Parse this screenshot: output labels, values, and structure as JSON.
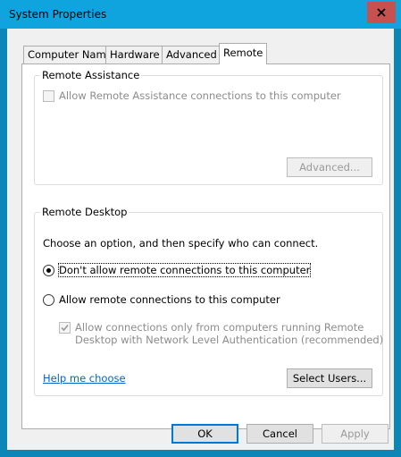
{
  "window": {
    "title": "System Properties",
    "close_label": "x"
  },
  "tabs": [
    {
      "label": "Computer Name",
      "active": false
    },
    {
      "label": "Hardware",
      "active": false
    },
    {
      "label": "Advanced",
      "active": false
    },
    {
      "label": "Remote",
      "active": true
    }
  ],
  "remote_assistance": {
    "group_title": "Remote Assistance",
    "allow_checkbox_label": "Allow Remote Assistance connections to this computer",
    "allow_checked": false,
    "allow_enabled": false,
    "advanced_button": "Advanced..."
  },
  "remote_desktop": {
    "group_title": "Remote Desktop",
    "instructions": "Choose an option, and then specify who can connect.",
    "option_dont_allow": "Don't allow remote connections to this computer",
    "option_allow": "Allow remote connections to this computer",
    "selected_option": "dont_allow",
    "nla_checkbox_line1": "Allow connections only from computers running Remote",
    "nla_checkbox_line2": "Desktop with Network Level Authentication (recommended)",
    "nla_checked": true,
    "nla_enabled": false,
    "help_link": "Help me choose",
    "select_users_button": "Select Users..."
  },
  "footer": {
    "ok": "OK",
    "cancel": "Cancel",
    "apply": "Apply"
  },
  "colors": {
    "titlebar": "#10a4df",
    "window_border": "#0c86b6",
    "close_button": "#c75050",
    "link": "#0066cc",
    "default_button_border": "#0078d7"
  }
}
